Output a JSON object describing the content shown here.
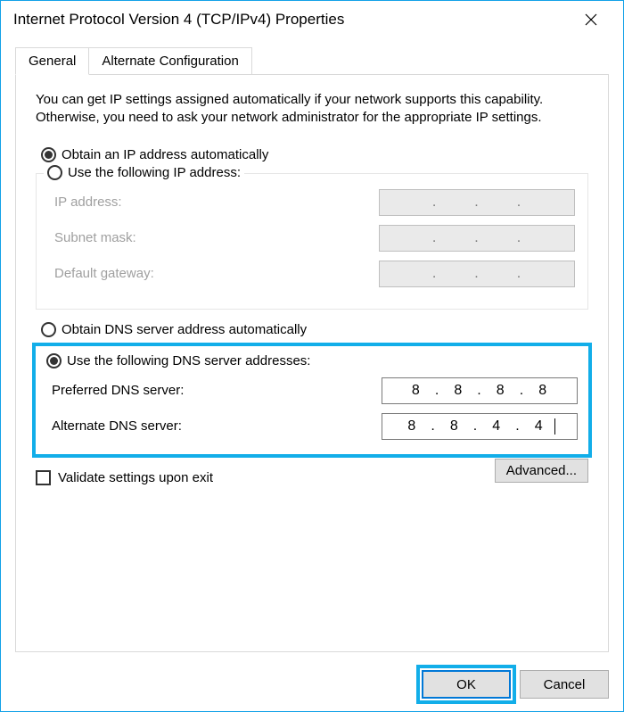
{
  "window": {
    "title": "Internet Protocol Version 4 (TCP/IPv4) Properties"
  },
  "tabs": {
    "general": "General",
    "alternate": "Alternate Configuration"
  },
  "intro": "You can get IP settings assigned automatically if your network supports this capability. Otherwise, you need to ask your network administrator for the appropriate IP settings.",
  "ip": {
    "obtain_auto": "Obtain an IP address automatically",
    "use_following": "Use the following IP address:",
    "ip_label": "IP address:",
    "subnet_label": "Subnet mask:",
    "gateway_label": "Default gateway:"
  },
  "dns": {
    "obtain_auto": "Obtain DNS server address automatically",
    "use_following": "Use the following DNS server addresses:",
    "preferred_label": "Preferred DNS server:",
    "alternate_label": "Alternate DNS server:",
    "preferred_octets": {
      "a": "8",
      "b": "8",
      "c": "8",
      "d": "8"
    },
    "alternate_octets": {
      "a": "8",
      "b": "8",
      "c": "4",
      "d": "4"
    }
  },
  "validate_label": "Validate settings upon exit",
  "buttons": {
    "advanced": "Advanced...",
    "ok": "OK",
    "cancel": "Cancel"
  }
}
